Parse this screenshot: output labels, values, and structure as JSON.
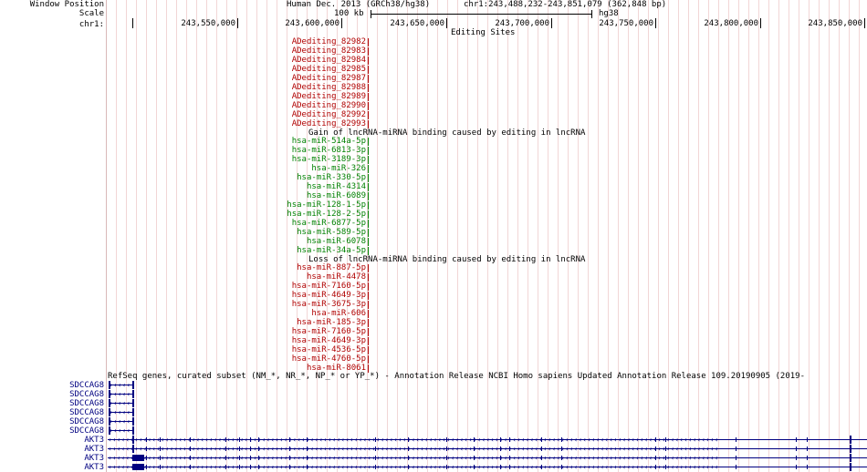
{
  "header": {
    "window_position_label": "Window Position",
    "scale_label": "Scale",
    "chrom_label": "chr1:",
    "assembly": "Human Dec. 2013 (GRCh38/hg38)",
    "position": "chr1:243,488,232-243,851,079 (362,848 bp)",
    "scale_text": "100 kb",
    "scale_genome": "hg38",
    "ticks": [
      "243,550,000",
      "243,600,000",
      "243,650,000",
      "243,700,000",
      "243,750,000",
      "243,800,000",
      "243,850,000"
    ]
  },
  "editing_track": {
    "title": "Editing Sites",
    "color": "#b00000",
    "sites": [
      "ADediting_82982",
      "ADediting_82983",
      "ADediting_82984",
      "ADediting_82985",
      "ADediting_82987",
      "ADediting_82988",
      "ADediting_82989",
      "ADediting_82990",
      "ADediting_82992",
      "ADediting_82993"
    ]
  },
  "gain_track": {
    "title": "Gain of lncRNA-miRNA binding caused by editing in lncRNA",
    "color": "#008000",
    "items": [
      "hsa-miR-514a-5p",
      "hsa-miR-6813-3p",
      "hsa-miR-3189-3p",
      "hsa-miR-326",
      "hsa-miR-330-5p",
      "hsa-miR-4314",
      "hsa-miR-6089",
      "hsa-miR-128-1-5p",
      "hsa-miR-128-2-5p",
      "hsa-miR-6877-5p",
      "hsa-miR-589-5p",
      "hsa-miR-6078",
      "hsa-miR-34a-5p"
    ]
  },
  "loss_track": {
    "title": "Loss of lncRNA-miRNA binding caused by editing in lncRNA",
    "color": "#b00000",
    "items": [
      "hsa-miR-887-5p",
      "hsa-miR-4478",
      "hsa-miR-7160-5p",
      "hsa-miR-4649-3p",
      "hsa-miR-3675-3p",
      "hsa-miR-606",
      "hsa-miR-185-3p",
      "hsa-miR-7160-5p",
      "hsa-miR-4649-3p",
      "hsa-miR-4536-5p",
      "hsa-miR-4760-5p",
      "hsa-miR-8061"
    ]
  },
  "refseq_track": {
    "title": "RefSeq genes, curated subset (NM_*, NR_*, NP_* or YP_*) - Annotation Release NCBI Homo sapiens Updated Annotation Release 109.20190905 (2019-",
    "color": "#000080",
    "genes": [
      "SDCCAG8",
      "SDCCAG8",
      "SDCCAG8",
      "SDCCAG8",
      "SDCCAG8",
      "SDCCAG8",
      "AKT3",
      "AKT3",
      "AKT3",
      "AKT3"
    ]
  }
}
